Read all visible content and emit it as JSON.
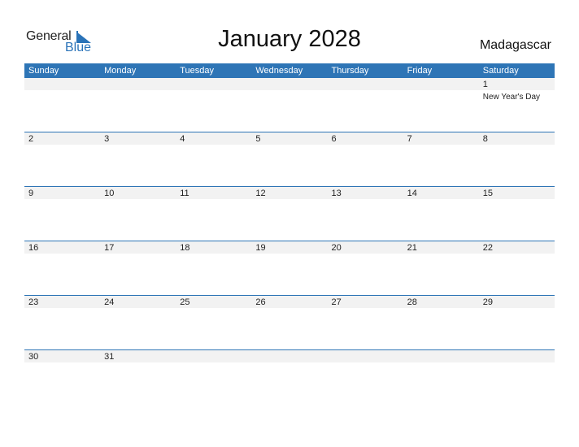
{
  "logo": {
    "general": "General",
    "blue": "Blue"
  },
  "title": "January 2028",
  "country": "Madagascar",
  "colors": {
    "accent": "#2e75b6",
    "strip": "#f2f2f2"
  },
  "weekdays": [
    "Sunday",
    "Monday",
    "Tuesday",
    "Wednesday",
    "Thursday",
    "Friday",
    "Saturday"
  ],
  "weeks": [
    [
      {
        "day": ""
      },
      {
        "day": ""
      },
      {
        "day": ""
      },
      {
        "day": ""
      },
      {
        "day": ""
      },
      {
        "day": ""
      },
      {
        "day": "1",
        "holiday": "New Year's Day"
      }
    ],
    [
      {
        "day": "2"
      },
      {
        "day": "3"
      },
      {
        "day": "4"
      },
      {
        "day": "5"
      },
      {
        "day": "6"
      },
      {
        "day": "7"
      },
      {
        "day": "8"
      }
    ],
    [
      {
        "day": "9"
      },
      {
        "day": "10"
      },
      {
        "day": "11"
      },
      {
        "day": "12"
      },
      {
        "day": "13"
      },
      {
        "day": "14"
      },
      {
        "day": "15"
      }
    ],
    [
      {
        "day": "16"
      },
      {
        "day": "17"
      },
      {
        "day": "18"
      },
      {
        "day": "19"
      },
      {
        "day": "20"
      },
      {
        "day": "21"
      },
      {
        "day": "22"
      }
    ],
    [
      {
        "day": "23"
      },
      {
        "day": "24"
      },
      {
        "day": "25"
      },
      {
        "day": "26"
      },
      {
        "day": "27"
      },
      {
        "day": "28"
      },
      {
        "day": "29"
      }
    ],
    [
      {
        "day": "30"
      },
      {
        "day": "31"
      },
      {
        "day": ""
      },
      {
        "day": ""
      },
      {
        "day": ""
      },
      {
        "day": ""
      },
      {
        "day": ""
      }
    ]
  ]
}
